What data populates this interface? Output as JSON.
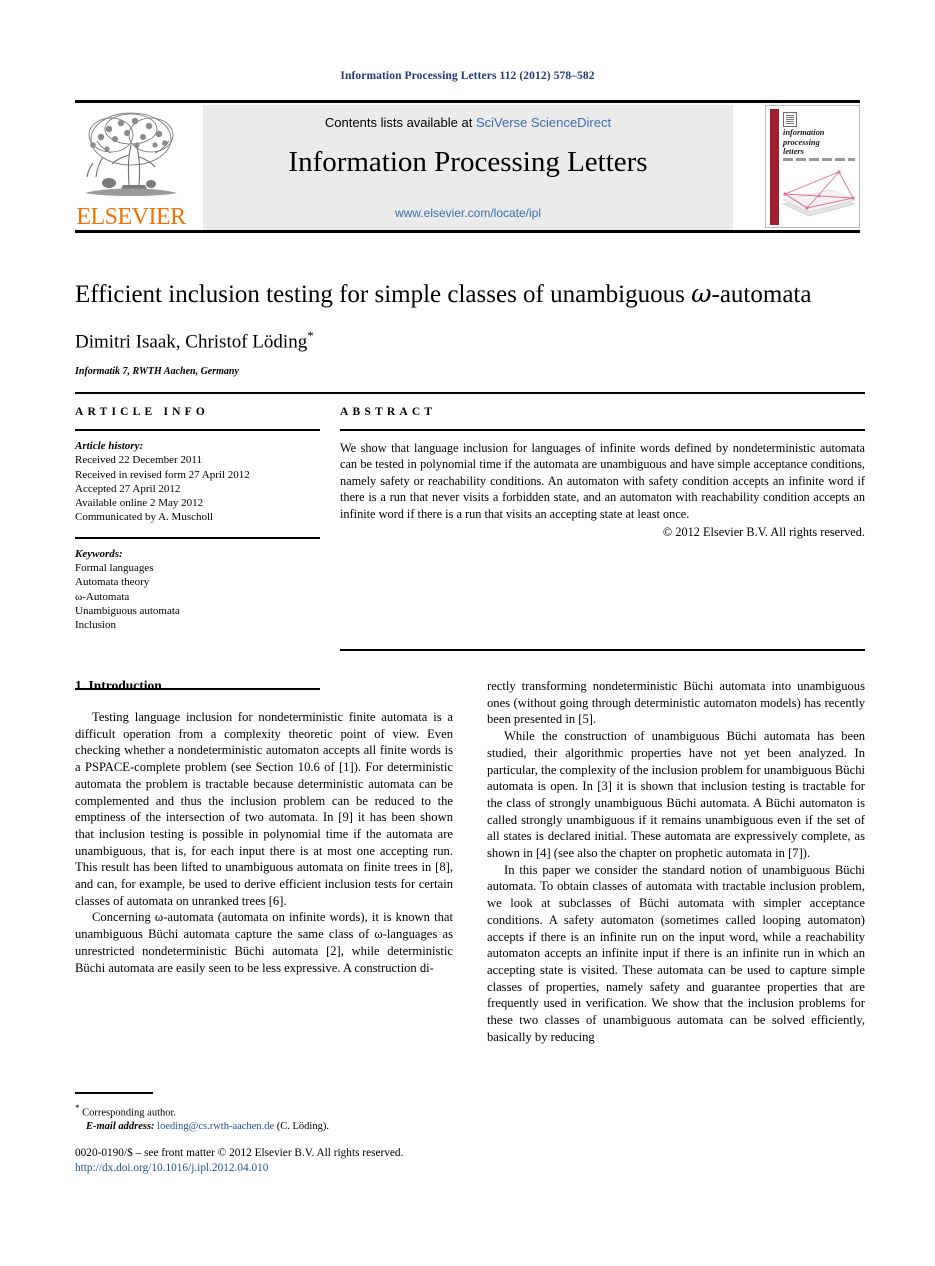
{
  "running_head": "Information Processing Letters 112 (2012) 578–582",
  "masthead": {
    "contents_prefix": "Contents lists available at ",
    "sciencedirect_link": "SciVerse ScienceDirect",
    "journal_title": "Information Processing Letters",
    "journal_url": "www.elsevier.com/locate/ipl",
    "publisher_name": "ELSEVIER",
    "cover": {
      "line1": "information",
      "line2": "processing",
      "line3": "letters"
    }
  },
  "title": {
    "main_before": "Efficient inclusion testing for simple classes of unambiguous ",
    "omega": "ω",
    "main_after": "-automata",
    "authors": "Dimitri Isaak, Christof Löding",
    "corresponding_marker": "*",
    "affiliation": "Informatik 7, RWTH Aachen, Germany"
  },
  "article_info": {
    "heading": "ARTICLE INFO",
    "history_label": "Article history:",
    "history": [
      "Received 22 December 2011",
      "Received in revised form 27 April 2012",
      "Accepted 27 April 2012",
      "Available online 2 May 2012",
      "Communicated by A. Muscholl"
    ],
    "keywords_label": "Keywords:",
    "keywords": [
      "Formal languages",
      "Automata theory",
      "ω-Automata",
      "Unambiguous automata",
      "Inclusion"
    ]
  },
  "abstract": {
    "heading": "ABSTRACT",
    "text": "We show that language inclusion for languages of infinite words defined by nondeterministic automata can be tested in polynomial time if the automata are unambiguous and have simple acceptance conditions, namely safety or reachability conditions. An automaton with safety condition accepts an infinite word if there is a run that never visits a forbidden state, and an automaton with reachability condition accepts an infinite word if there is a run that visits an accepting state at least once.",
    "copyright": "© 2012 Elsevier B.V. All rights reserved."
  },
  "body": {
    "section_heading": "1. Introduction",
    "left_paragraphs": [
      "Testing language inclusion for nondeterministic finite automata is a difficult operation from a complexity theoretic point of view. Even checking whether a nondeterministic automaton accepts all finite words is a PSPACE-complete problem (see Section 10.6 of [1]). For deterministic automata the problem is tractable because deterministic automata can be complemented and thus the inclusion problem can be reduced to the emptiness of the intersection of two automata. In [9] it has been shown that inclusion testing is possible in polynomial time if the automata are unambiguous, that is, for each input there is at most one accepting run. This result has been lifted to unambiguous automata on finite trees in [8], and can, for example, be used to derive efficient inclusion tests for certain classes of automata on unranked trees [6].",
      "Concerning ω-automata (automata on infinite words), it is known that unambiguous Büchi automata capture the same class of ω-languages as unrestricted nondeterministic Büchi automata [2], while deterministic Büchi automata are easily seen to be less expressive. A construction di-"
    ],
    "right_paragraphs": [
      "rectly transforming nondeterministic Büchi automata into unambiguous ones (without going through deterministic automaton models) has recently been presented in [5].",
      "While the construction of unambiguous Büchi automata has been studied, their algorithmic properties have not yet been analyzed. In particular, the complexity of the inclusion problem for unambiguous Büchi automata is open. In [3] it is shown that inclusion testing is tractable for the class of strongly unambiguous Büchi automata. A Büchi automaton is called strongly unambiguous if it remains unambiguous even if the set of all states is declared initial. These automata are expressively complete, as shown in [4] (see also the chapter on prophetic automata in [7]).",
      "In this paper we consider the standard notion of unambiguous Büchi automata. To obtain classes of automata with tractable inclusion problem, we look at subclasses of Büchi automata with simpler acceptance conditions. A safety automaton (sometimes called looping automaton) accepts if there is an infinite run on the input word, while a reachability automaton accepts an infinite input if there is an infinite run in which an accepting state is visited. These automata can be used to capture simple classes of properties, namely safety and guarantee properties that are frequently used in verification. We show that the inclusion problems for these two classes of unambiguous automata can be solved efficiently, basically by reducing"
    ]
  },
  "footnote": {
    "star": "*",
    "corresponding_author": "Corresponding author.",
    "email_label": "E-mail address:",
    "email": "loeding@cs.rwth-aachen.de",
    "email_owner": "(C. Löding)."
  },
  "footer": {
    "issn_line": "0020-0190/$ – see front matter © 2012 Elsevier B.V. All rights reserved.",
    "doi": "http://dx.doi.org/10.1016/j.ipl.2012.04.010"
  },
  "colors": {
    "running_head": "#1f3a77",
    "link": "#3a6fb0",
    "doi_link": "#1f4f9c",
    "elsevier_orange": "#ee7203",
    "cover_spine": "#9e1f2f",
    "banner_bg": "#ebebeb"
  }
}
